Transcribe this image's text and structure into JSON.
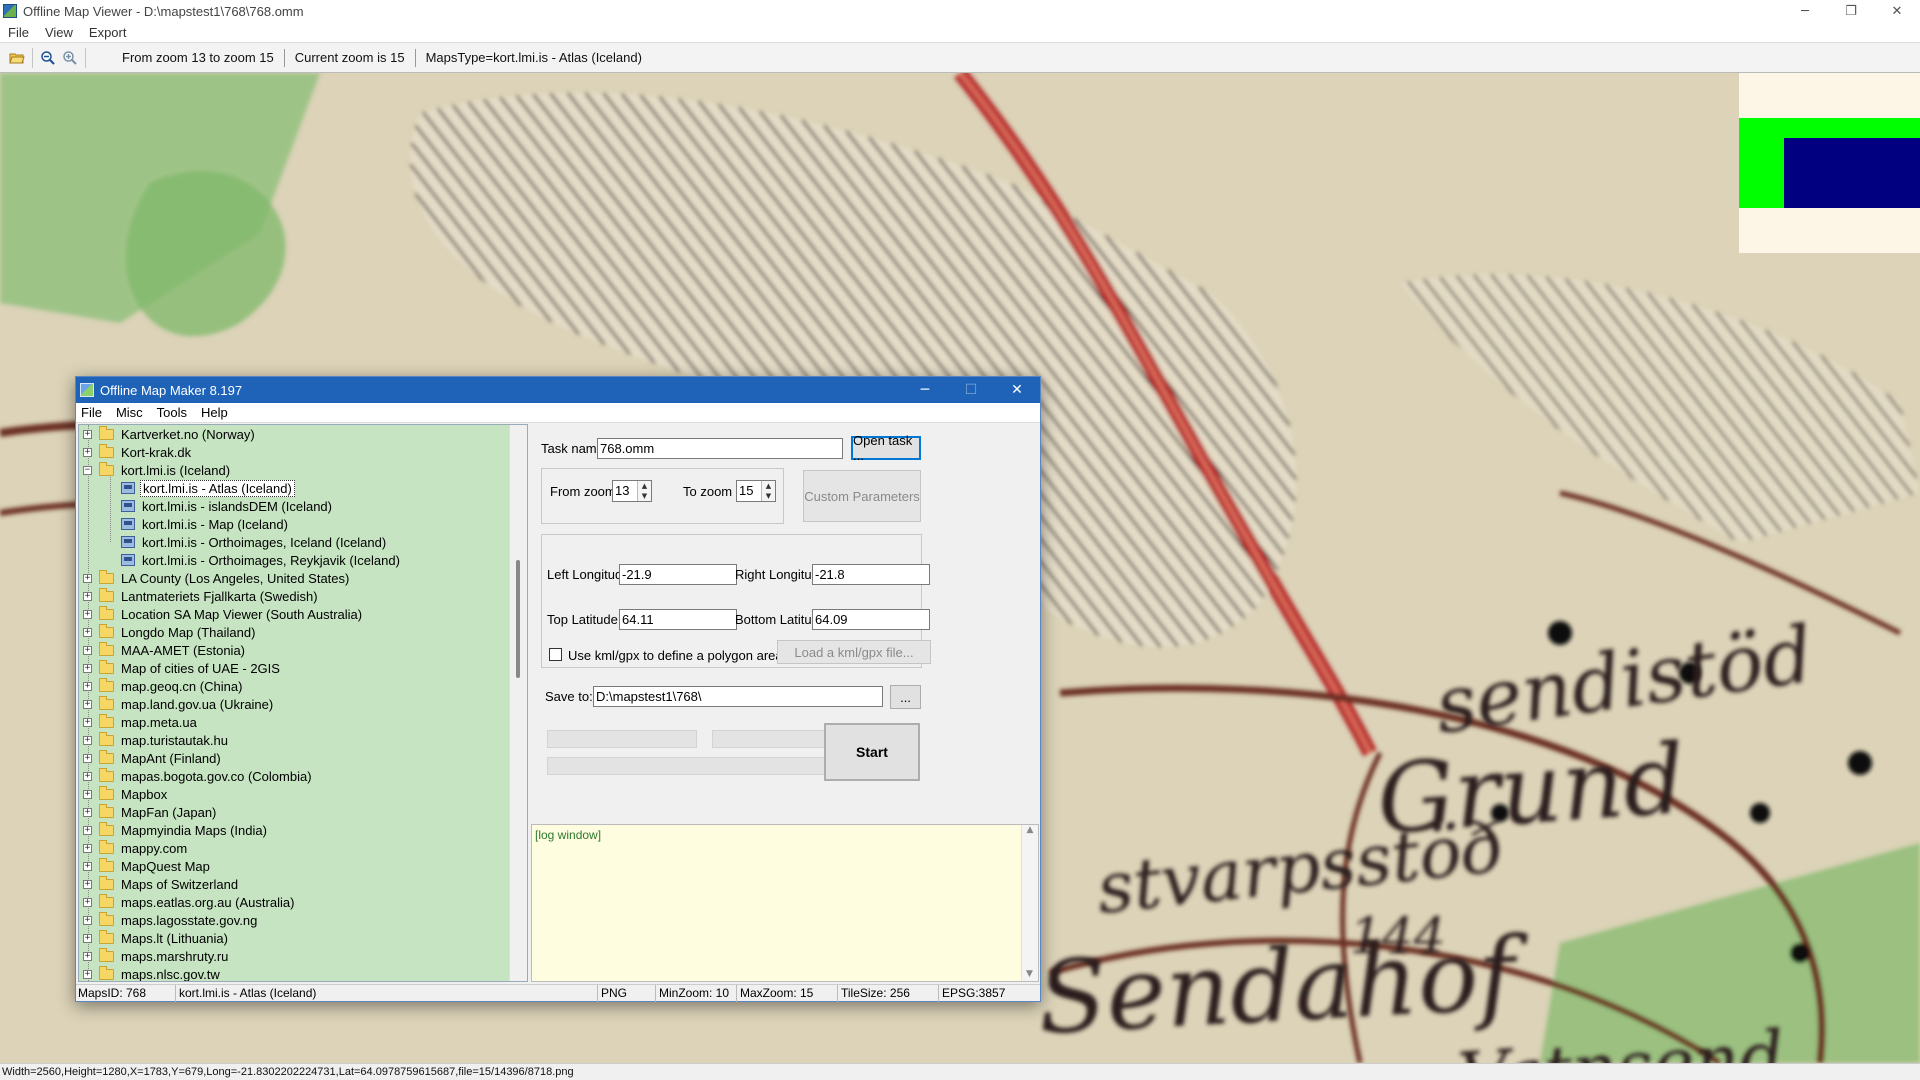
{
  "viewer": {
    "title": "Offline Map Viewer - D:\\mapstest1\\768\\768.omm",
    "menu": [
      "File",
      "View",
      "Export"
    ],
    "toolbar": {
      "zoom_range": "From zoom 13 to zoom 15",
      "current_zoom": "Current zoom is 15",
      "maps_type": "MapsType=kort.lmi.is - Atlas (Iceland)"
    },
    "status": "Width=2560,Height=1280,X=1783,Y=679,Long=-21.8302202224731,Lat=64.0978759615687,file=15/14396/8718.png",
    "map_labels": [
      "sendistöd",
      "Grund",
      "stvarpsstöð",
      "144",
      "Sendahof",
      "Vatnsend"
    ]
  },
  "maker": {
    "title": "Offline Map Maker 8.197",
    "menu": [
      "File",
      "Misc",
      "Tools",
      "Help"
    ],
    "tree": [
      {
        "label": "Kartverket.no (Norway)",
        "type": "folder",
        "expander": "+"
      },
      {
        "label": "Kort-krak.dk",
        "type": "folder",
        "expander": "+"
      },
      {
        "label": "kort.lmi.is (Iceland)",
        "type": "folder-open",
        "expander": "−"
      },
      {
        "label": "kort.lmi.is - Atlas (Iceland)",
        "type": "map",
        "selected": true
      },
      {
        "label": "kort.lmi.is - islandsDEM (Iceland)",
        "type": "map"
      },
      {
        "label": "kort.lmi.is - Map (Iceland)",
        "type": "map"
      },
      {
        "label": "kort.lmi.is - Orthoimages, Iceland (Iceland)",
        "type": "map"
      },
      {
        "label": "kort.lmi.is - Orthoimages, Reykjavik (Iceland)",
        "type": "map"
      },
      {
        "label": "LA County (Los Angeles, United States)",
        "type": "folder",
        "expander": "+"
      },
      {
        "label": "Lantmateriets Fjallkarta (Swedish)",
        "type": "folder",
        "expander": "+"
      },
      {
        "label": "Location SA Map Viewer (South Australia)",
        "type": "folder",
        "expander": "+"
      },
      {
        "label": "Longdo Map (Thailand)",
        "type": "folder",
        "expander": "+"
      },
      {
        "label": "MAA-AMET (Estonia)",
        "type": "folder",
        "expander": "+"
      },
      {
        "label": "Map of cities of UAE - 2GIS",
        "type": "folder",
        "expander": "+"
      },
      {
        "label": "map.geoq.cn (China)",
        "type": "folder",
        "expander": "+"
      },
      {
        "label": "map.land.gov.ua (Ukraine)",
        "type": "folder",
        "expander": "+"
      },
      {
        "label": "map.meta.ua",
        "type": "folder",
        "expander": "+"
      },
      {
        "label": "map.turistautak.hu",
        "type": "folder",
        "expander": "+"
      },
      {
        "label": "MapAnt (Finland)",
        "type": "folder",
        "expander": "+"
      },
      {
        "label": "mapas.bogota.gov.co (Colombia)",
        "type": "folder",
        "expander": "+"
      },
      {
        "label": "Mapbox",
        "type": "folder",
        "expander": "+"
      },
      {
        "label": "MapFan (Japan)",
        "type": "folder",
        "expander": "+"
      },
      {
        "label": "Mapmyindia Maps (India)",
        "type": "folder",
        "expander": "+"
      },
      {
        "label": "mappy.com",
        "type": "folder",
        "expander": "+"
      },
      {
        "label": "MapQuest Map",
        "type": "folder",
        "expander": "+"
      },
      {
        "label": "Maps of Switzerland",
        "type": "folder",
        "expander": "+"
      },
      {
        "label": "maps.eatlas.org.au (Australia)",
        "type": "folder",
        "expander": "+"
      },
      {
        "label": "maps.lagosstate.gov.ng",
        "type": "folder",
        "expander": "+"
      },
      {
        "label": "Maps.lt (Lithuania)",
        "type": "folder",
        "expander": "+"
      },
      {
        "label": "maps.marshruty.ru",
        "type": "folder",
        "expander": "+"
      },
      {
        "label": "maps.nlsc.gov.tw",
        "type": "folder",
        "expander": "+"
      }
    ],
    "form": {
      "task_name_label": "Task name",
      "task_name_value": "768.omm",
      "open_task": "Open task ...",
      "from_zoom_label": "From zoom",
      "from_zoom_value": "13",
      "to_zoom_label": "To zoom",
      "to_zoom_value": "15",
      "custom_params": "Custom Parameters",
      "left_lon_label": "Left Longitude",
      "left_lon_value": "-21.9",
      "right_lon_label": "Right Longitude",
      "right_lon_value": "-21.8",
      "top_lat_label": "Top Latitude",
      "top_lat_value": "64.11",
      "bottom_lat_label": "Bottom Latitude",
      "bottom_lat_value": "64.09",
      "kml_label": "Use kml/gpx to define a polygon area",
      "kml_button": "Load a kml/gpx file...",
      "save_to_label": "Save to:",
      "save_to_value": "D:\\mapstest1\\768\\",
      "browse": "...",
      "start": "Start"
    },
    "log": "[log window]",
    "status": {
      "maps_id": "MapsID: 768",
      "maps_name": "kort.lmi.is - Atlas (Iceland)",
      "format": "PNG",
      "min_zoom": "MinZoom: 10",
      "max_zoom": "MaxZoom: 15",
      "tile_size": "TileSize: 256",
      "epsg": "EPSG:3857"
    }
  }
}
